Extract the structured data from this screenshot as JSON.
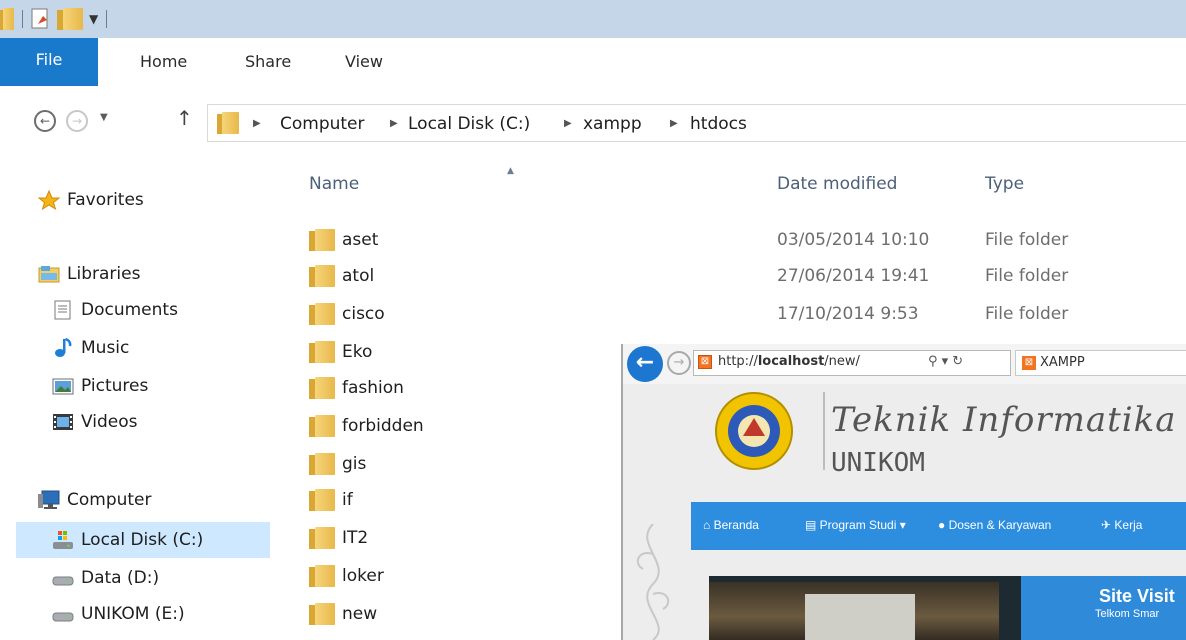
{
  "explorer": {
    "ribbon_tabs": [
      "File",
      "Home",
      "Share",
      "View"
    ],
    "breadcrumb": [
      "Computer",
      "Local Disk (C:)",
      "xampp",
      "htdocs"
    ],
    "nav_pane": {
      "favorites": "Favorites",
      "libraries": "Libraries",
      "library_items": [
        "Documents",
        "Music",
        "Pictures",
        "Videos"
      ],
      "computer": "Computer",
      "drives": [
        "Local Disk (C:)",
        "Data (D:)",
        "UNIKOM (E:)"
      ]
    },
    "columns": {
      "name": "Name",
      "date": "Date modified",
      "type": "Type"
    },
    "rows": [
      {
        "name": "aset",
        "date": "03/05/2014 10:10",
        "type": "File folder"
      },
      {
        "name": "atol",
        "date": "27/06/2014 19:41",
        "type": "File folder"
      },
      {
        "name": "cisco",
        "date": "17/10/2014 9:53",
        "type": "File folder"
      },
      {
        "name": "Eko",
        "date": "",
        "type": ""
      },
      {
        "name": "fashion",
        "date": "",
        "type": ""
      },
      {
        "name": "forbidden",
        "date": "",
        "type": ""
      },
      {
        "name": "gis",
        "date": "",
        "type": ""
      },
      {
        "name": "if",
        "date": "",
        "type": ""
      },
      {
        "name": "IT2",
        "date": "",
        "type": ""
      },
      {
        "name": "loker",
        "date": "",
        "type": ""
      },
      {
        "name": "new",
        "date": "",
        "type": ""
      }
    ]
  },
  "browser": {
    "url_prefix": "http://",
    "url_host": "localhost",
    "url_path": "/new/",
    "tab_title": "XAMPP",
    "site_title": "Teknik Informatika",
    "site_subtitle": "UNIKOM",
    "menu": [
      "Beranda",
      "Program Studi",
      "Dosen & Karyawan",
      "Kerja"
    ],
    "slide_heading": "Site Visit",
    "slide_subtext": "Telkom Smar"
  },
  "colors": {
    "titlebar": "#c5d6e8",
    "file_tab": "#1979ca",
    "selection": "#cde8ff",
    "site_menu": "#2d8ee0"
  }
}
